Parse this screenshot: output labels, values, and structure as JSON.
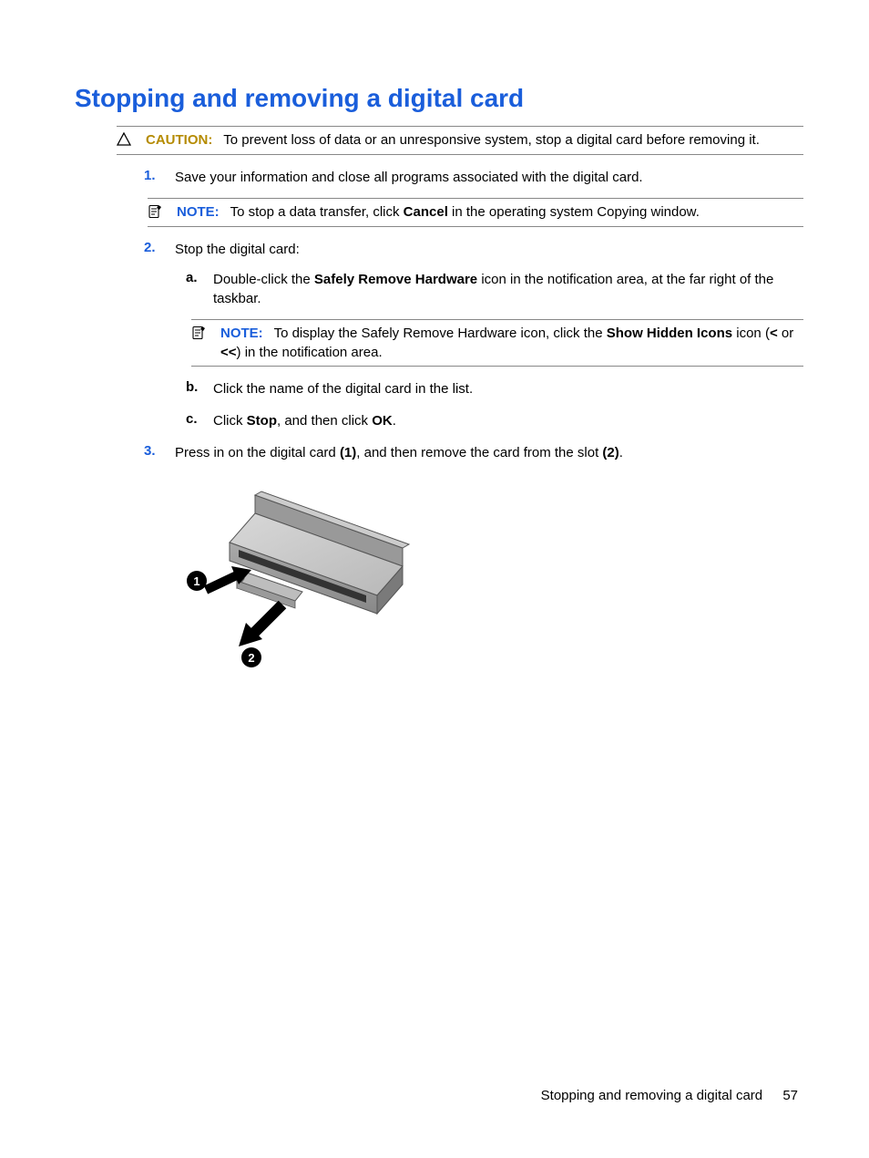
{
  "title": "Stopping and removing a digital card",
  "caution": {
    "label": "CAUTION:",
    "text": "To prevent loss of data or an unresponsive system, stop a digital card before removing it."
  },
  "steps": {
    "s1": "Save your information and close all programs associated with the digital card.",
    "note1": {
      "label": "NOTE:",
      "pre": "To stop a data transfer, click ",
      "b1": "Cancel",
      "post": " in the operating system Copying window."
    },
    "s2": "Stop the digital card:",
    "s2a_pre": "Double-click the ",
    "s2a_b": "Safely Remove Hardware",
    "s2a_post": " icon in the notification area, at the far right of the taskbar.",
    "note2": {
      "label": "NOTE:",
      "pre": "To display the Safely Remove Hardware icon, click the ",
      "b1": "Show Hidden Icons",
      "mid": " icon (",
      "b2": "<",
      "or": " or ",
      "b3": "<<",
      "post": ") in the notification area."
    },
    "s2b": "Click the name of the digital card in the list.",
    "s2c_pre": "Click ",
    "s2c_b1": "Stop",
    "s2c_mid": ", and then click ",
    "s2c_b2": "OK",
    "s2c_post": ".",
    "s3_pre": "Press in on the digital card ",
    "s3_b1": "(1)",
    "s3_mid": ", and then remove the card from the slot ",
    "s3_b2": "(2)",
    "s3_post": "."
  },
  "diagram": {
    "label1": "1",
    "label2": "2"
  },
  "footer": {
    "text": "Stopping and removing a digital card",
    "page": "57"
  }
}
